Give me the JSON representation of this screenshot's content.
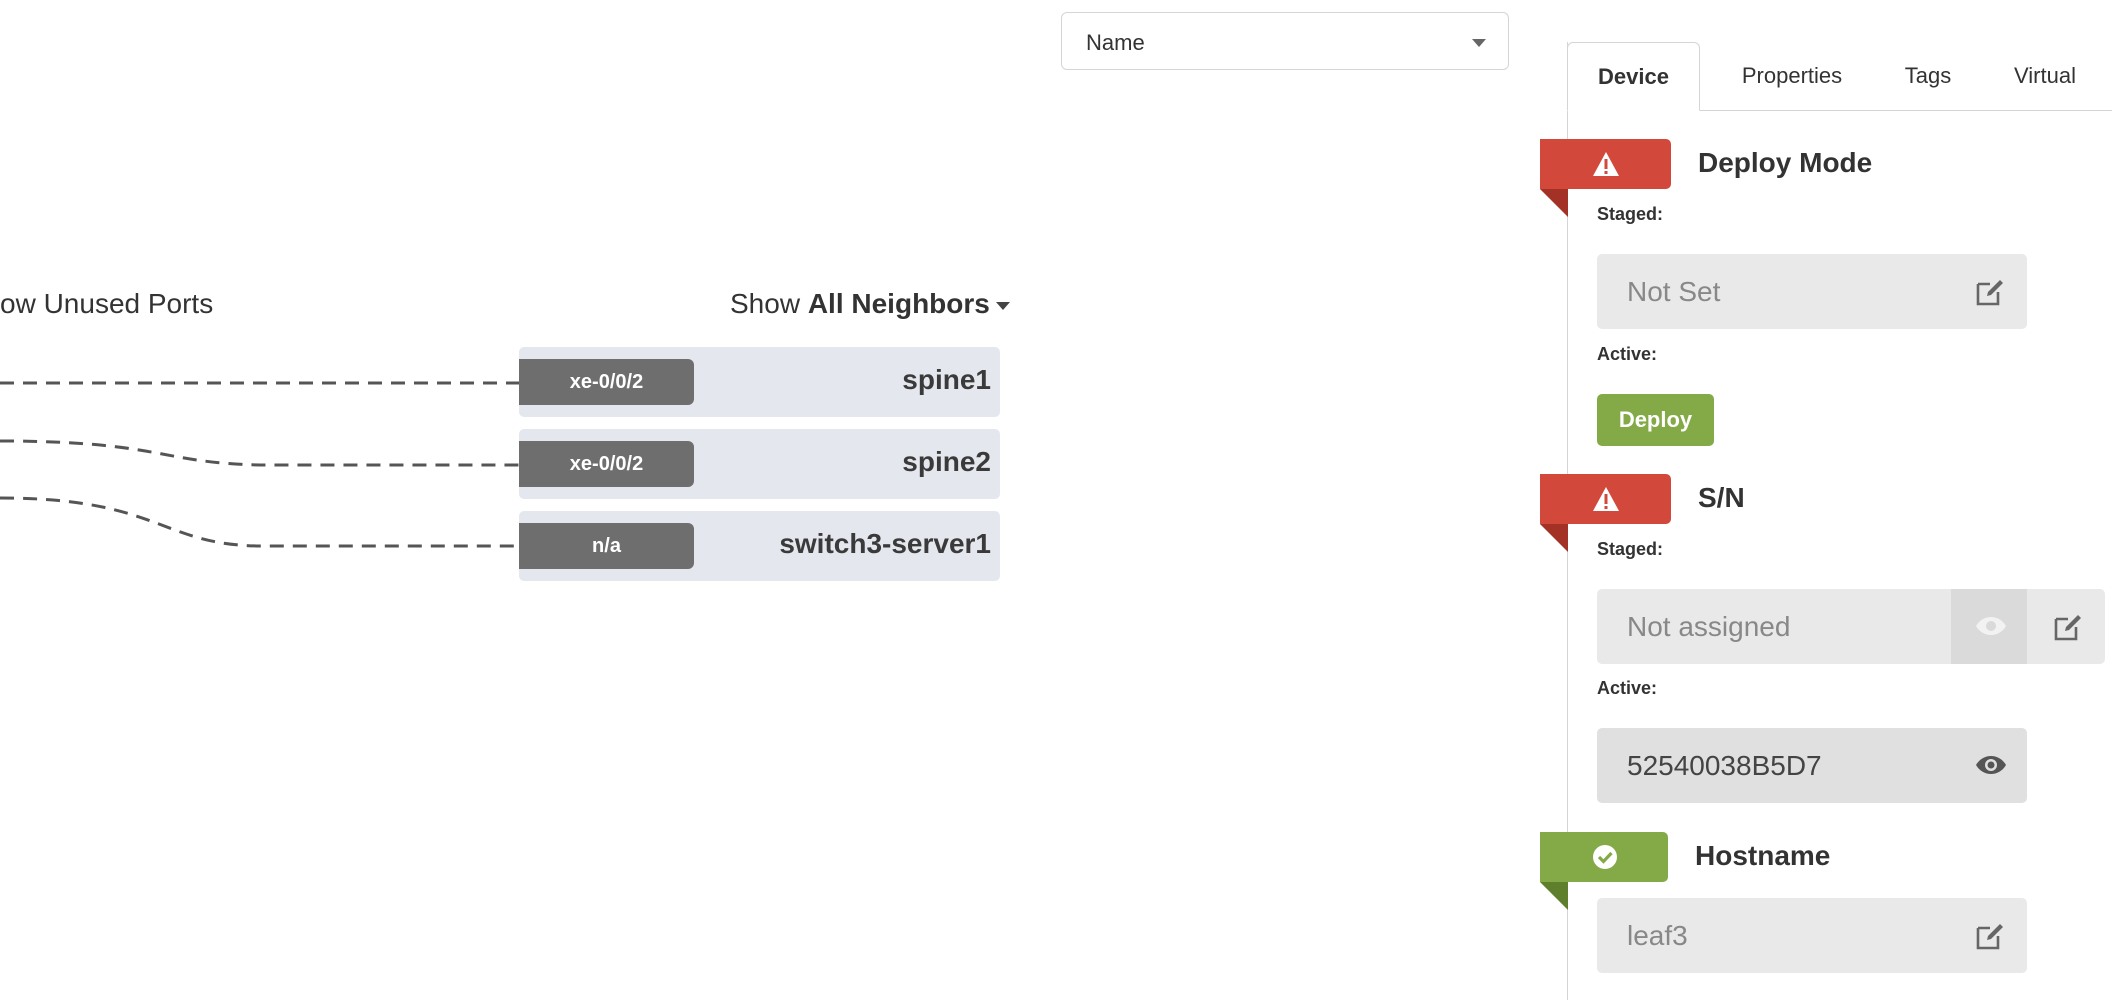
{
  "toolbar": {
    "name_select_value": "Name"
  },
  "topology": {
    "unused_ports_label": "ow Unused Ports",
    "neighbors_prefix": "Show",
    "neighbors_value": "All Neighbors",
    "neighbors": [
      {
        "port": "xe-0/0/2",
        "name": "spine1"
      },
      {
        "port": "xe-0/0/2",
        "name": "spine2"
      },
      {
        "port": "n/a",
        "name": "switch3-server1"
      }
    ]
  },
  "panel": {
    "tabs": [
      {
        "label": "Device",
        "active": true
      },
      {
        "label": "Properties",
        "active": false
      },
      {
        "label": "Tags",
        "active": false
      },
      {
        "label": "Virtual",
        "active": false
      }
    ],
    "deploy_mode": {
      "title": "Deploy Mode",
      "status": "error",
      "staged_label": "Staged:",
      "staged_value": "Not Set",
      "active_label": "Active:",
      "deploy_button": "Deploy"
    },
    "serial": {
      "title": "S/N",
      "status": "error",
      "staged_label": "Staged:",
      "staged_value": "Not assigned",
      "active_label": "Active:",
      "active_value": "52540038B5D7"
    },
    "hostname": {
      "title": "Hostname",
      "status": "ok",
      "value": "leaf3"
    }
  },
  "colors": {
    "error": "#d2483a",
    "ok": "#84aa48",
    "badge": "#6e6e6e",
    "row_bg": "#e4e7ed"
  }
}
